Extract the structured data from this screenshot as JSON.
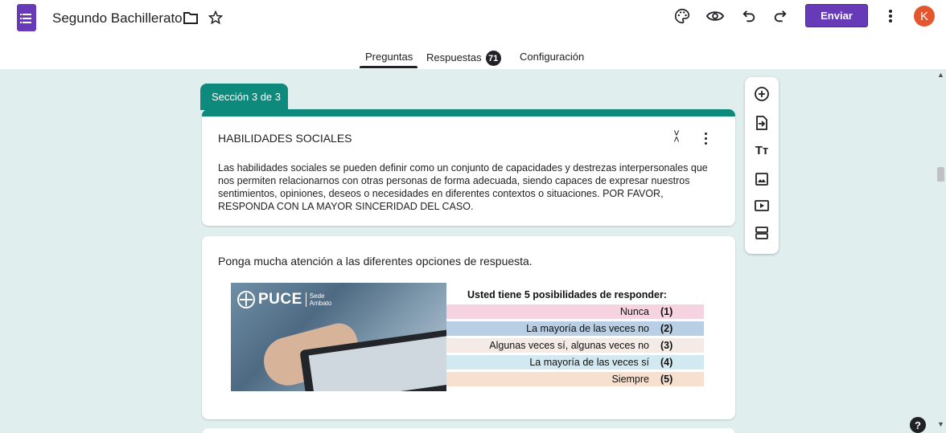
{
  "header": {
    "title": "Segundo Bachillerato",
    "send_label": "Enviar",
    "avatar_initial": "K",
    "icons": [
      "forms-app-icon",
      "folder-icon",
      "star-icon",
      "palette-icon",
      "preview-eye-icon",
      "undo-icon",
      "redo-icon",
      "more-vert-icon"
    ]
  },
  "tabs": [
    {
      "label": "Preguntas",
      "active": true
    },
    {
      "label": "Respuestas",
      "badge": "71"
    },
    {
      "label": "Configuración"
    }
  ],
  "section": {
    "tab_label": "Sección 3 de 3",
    "title": "HABILIDADES SOCIALES",
    "description": "Las habilidades sociales se pueden definir como un conjunto de capacidades y destrezas interpersonales que nos permiten relacionarnos con otras personas de forma adecuada, siendo capaces de expresar nuestros sentimientos, opiniones, deseos o necesidades en diferentes contextos o situaciones. POR FAVOR, RESPONDA CON LA MAYOR SINCERIDAD DEL CASO."
  },
  "question": {
    "text": "Ponga mucha atención a las diferentes opciones de respuesta.",
    "image": {
      "logo_text": "PUCE",
      "logo_sub_1": "Sede",
      "logo_sub_2": "Ambato",
      "scale_title": "Usted tiene 5 posibilidades de responder:",
      "options": [
        {
          "label": "Nunca",
          "num": "(1)",
          "color": "#f6d3e0"
        },
        {
          "label": "La mayoría de las veces no",
          "num": "(2)",
          "color": "#b9cfe6"
        },
        {
          "label": "Algunas veces sí, algunas veces no",
          "num": "(3)",
          "color": "#f5ebe6"
        },
        {
          "label": "La mayoría de las veces sí",
          "num": "(4)",
          "color": "#d2e9f2"
        },
        {
          "label": "Siempre",
          "num": "(5)",
          "color": "#f7e0cf"
        }
      ]
    }
  },
  "toolbar": {
    "icons": [
      "add-question-icon",
      "import-questions-icon",
      "add-title-icon",
      "add-image-icon",
      "add-video-icon",
      "add-section-icon"
    ]
  },
  "colors": {
    "accent": "#673ab7",
    "theme": "#0e8a7c",
    "background": "#e0efee",
    "avatar": "#e4572e"
  }
}
